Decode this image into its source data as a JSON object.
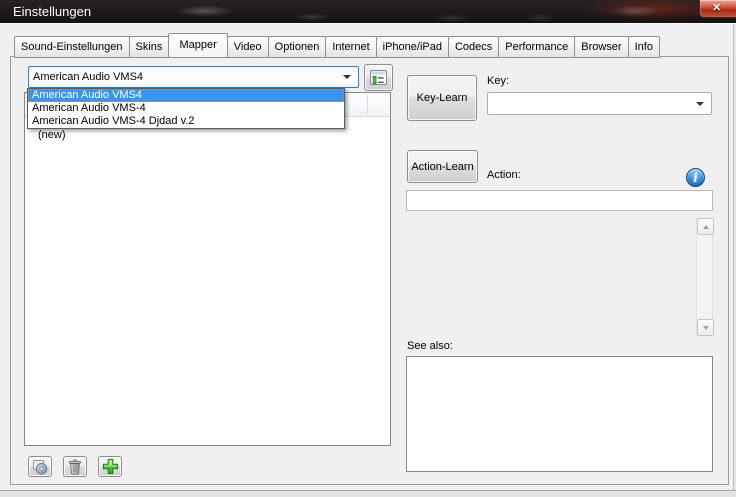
{
  "window": {
    "title": "Einstellungen",
    "close_glyph": "✕"
  },
  "tabs": {
    "items": [
      "Sound-Einstellungen",
      "Skins",
      "Mapper",
      "Video",
      "Optionen",
      "Internet",
      "iPhone/iPad",
      "Codecs",
      "Performance",
      "Browser",
      "Info"
    ],
    "active": "Mapper",
    "active_index": 2
  },
  "mapper": {
    "device_combo": {
      "value": "American Audio VMS4"
    },
    "device_dropdown": {
      "items": [
        "American Audio VMS4",
        "American Audio VMS-4",
        "American Audio VMS-4 Djdad v.2"
      ],
      "selected_index": 0
    },
    "mapping_list": {
      "rows": [
        "(new)"
      ]
    },
    "key_learn_button": "Key-Learn",
    "key_label": "Key:",
    "key_combo_value": "",
    "action_learn_button": "Action-Learn",
    "action_label": "Action:",
    "action_value": "",
    "info_glyph": "i",
    "see_also_label": "See also:",
    "see_also_items": []
  },
  "icons": {
    "mapping_list_button": "list-window-icon",
    "bottom_buttons": [
      "window-disc-icon",
      "trash-icon",
      "plus-icon"
    ]
  },
  "colors": {
    "dialog_bg": "#f0f0f0",
    "selection_blue": "#3795f3",
    "focus_border_blue": "#3c7fb1",
    "close_button_red": "#c13f2a",
    "add_green": "#2fb21e"
  }
}
